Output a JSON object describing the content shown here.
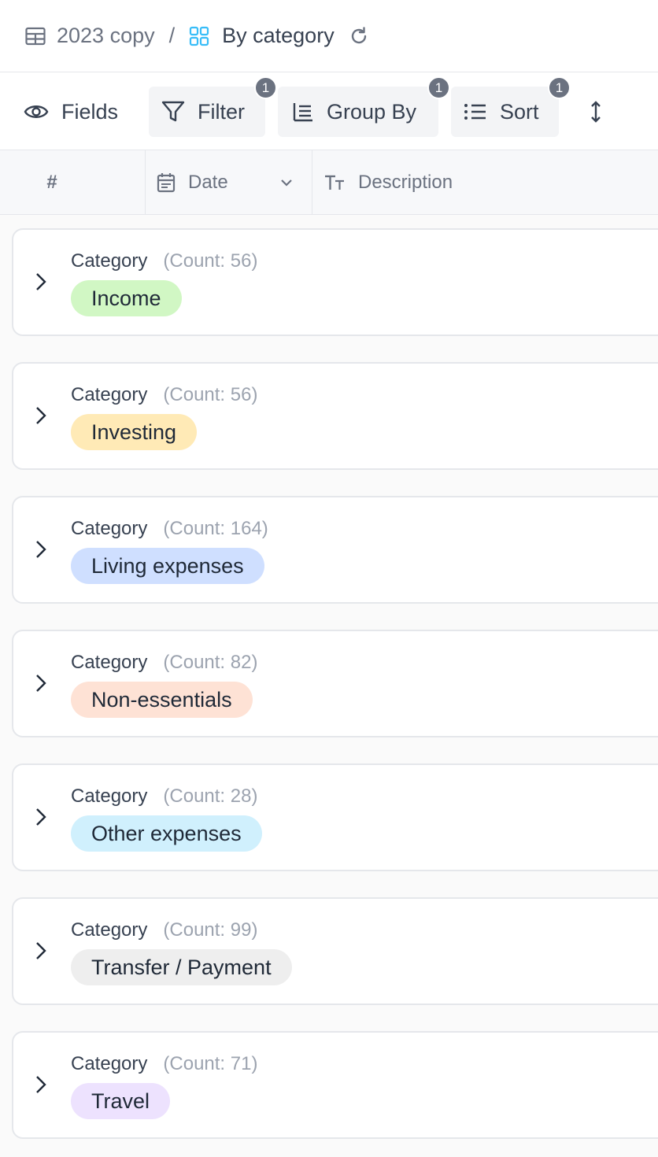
{
  "breadcrumb": {
    "table_name": "2023 copy",
    "separator": "/",
    "view_name": "By category"
  },
  "toolbar": {
    "fields_label": "Fields",
    "filter_label": "Filter",
    "filter_count": "1",
    "group_label": "Group By",
    "group_count": "1",
    "sort_label": "Sort",
    "sort_count": "1"
  },
  "columns": {
    "row_number": "#",
    "date": "Date",
    "description": "Description"
  },
  "groups": [
    {
      "field": "Category",
      "count": "(Count: 56)",
      "value": "Income",
      "color": "#d1f7c4"
    },
    {
      "field": "Category",
      "count": "(Count: 56)",
      "value": "Investing",
      "color": "#ffeab6"
    },
    {
      "field": "Category",
      "count": "(Count: 164)",
      "value": "Living expenses",
      "color": "#cfdfff"
    },
    {
      "field": "Category",
      "count": "(Count: 82)",
      "value": "Non-essentials",
      "color": "#fee2d5"
    },
    {
      "field": "Category",
      "count": "(Count: 28)",
      "value": "Other expenses",
      "color": "#d0f0fd"
    },
    {
      "field": "Category",
      "count": "(Count: 99)",
      "value": "Transfer / Payment",
      "color": "#eeeeee"
    },
    {
      "field": "Category",
      "count": "(Count: 71)",
      "value": "Travel",
      "color": "#ede2fe"
    }
  ]
}
